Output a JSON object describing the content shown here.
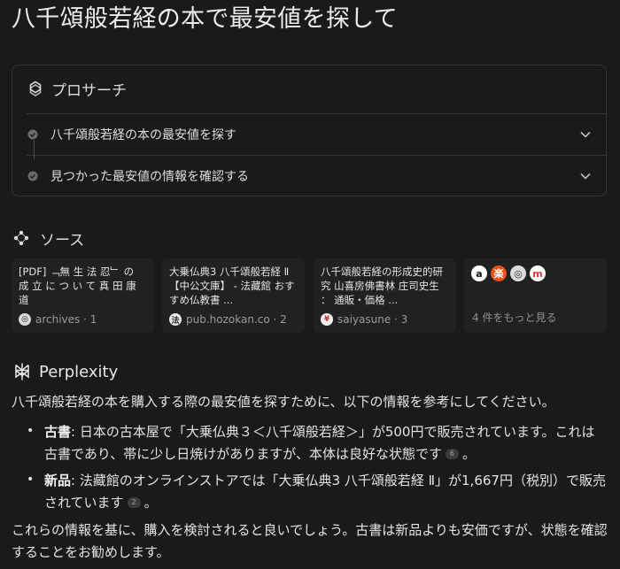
{
  "query": "八千頌般若経の本で最安値を探して",
  "pro_search": {
    "label": "プロサーチ",
    "steps": [
      {
        "label": "八千頌般若経の本の最安値を探す"
      },
      {
        "label": "見つかった最安値の情報を確認する"
      }
    ]
  },
  "sources": {
    "label": "ソース",
    "cards": [
      {
        "title": "[PDF] ﹁無 生 法 忍﹂ の 成 立 に つ い て 真 田 康 道",
        "site": "archives · 1",
        "favicon": "globe-icon"
      },
      {
        "title": "大乗仏典3 八千頌般若経 Ⅱ 【中公文庫】 - 法藏館 おすすめ仏教書 ...",
        "site": "pub.hozokan.co · 2",
        "favicon": "hozokan-favicon"
      },
      {
        "title": "八千頌般若経の形成史的研究 山喜房佛書林 庄司史生 ： 通販・価格 ...",
        "site": "saiyasune · 3",
        "favicon": "saiyasune-favicon"
      }
    ],
    "more": {
      "label": "4 件をもっと見る",
      "icons": [
        "amazon-icon",
        "rakuten-icon",
        "globe-icon",
        "mercari-icon"
      ]
    }
  },
  "answer": {
    "brand": "Perplexity",
    "intro": "八千頌般若経の本を購入する際の最安値を探すために、以下の情報を参考にしてください。",
    "bullets": [
      {
        "label": "古書",
        "text": ": 日本の古本屋で「大乗仏典３＜八千頌般若経＞」が500円で販売されています。これは古書であり、帯に少し日焼けがありますが、本体は良好な状態です",
        "cite": "6",
        "end": "。"
      },
      {
        "label": "新品",
        "text": ": 法藏館のオンラインストアでは「大乗仏典3 八千頌般若経 Ⅱ」が1,667円（税別）で販売されています",
        "cite": "2",
        "end": "。"
      }
    ],
    "conclusion": "これらの情報を基に、購入を検討されると良いでしょう。古書は新品よりも安価ですが、状態を確認することをお勧めします。"
  },
  "colors": {
    "background": "#191a1a",
    "card": "#202222",
    "border": "#343636",
    "text": "#e8e8e6",
    "muted": "#9a9c9c"
  }
}
